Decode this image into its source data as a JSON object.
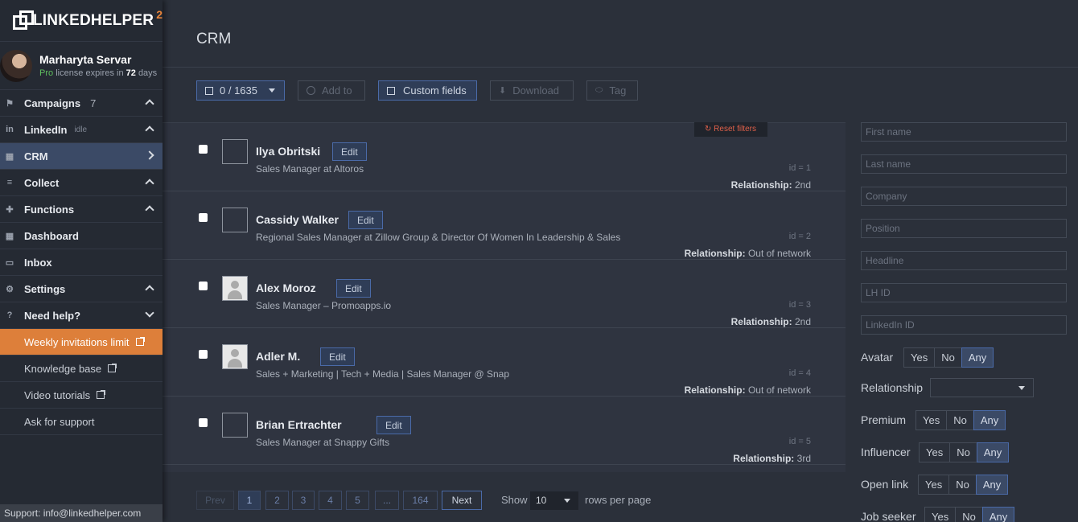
{
  "brand": {
    "name": "LINKEDHELPER",
    "version": "2"
  },
  "user": {
    "name": "Marharyta Servar",
    "plan": "Pro",
    "license_pre": "license expires in",
    "days": "72",
    "days_suffix": "days"
  },
  "nav": [
    {
      "label": "Campaigns",
      "icon": "flag-icon",
      "count": "7",
      "chev": "up"
    },
    {
      "label": "LinkedIn",
      "icon": "linkedin-icon",
      "sub": "idle",
      "chev": "up"
    },
    {
      "label": "CRM",
      "icon": "grid-icon",
      "chev": "right",
      "active": true
    },
    {
      "label": "Collect",
      "icon": "collect-icon",
      "chev": "up"
    },
    {
      "label": "Functions",
      "icon": "puzzle-icon",
      "chev": "up"
    },
    {
      "label": "Dashboard",
      "icon": "dashboard-icon"
    },
    {
      "label": "Inbox",
      "icon": "inbox-icon"
    },
    {
      "label": "Settings",
      "icon": "gear-icon",
      "chev": "up"
    },
    {
      "label": "Need help?",
      "icon": "help-icon",
      "chev": "down"
    }
  ],
  "help_links": [
    {
      "label": "Weekly invitations limit",
      "highlight": true
    },
    {
      "label": "Knowledge base"
    },
    {
      "label": "Video tutorials"
    },
    {
      "label": "Ask for support"
    }
  ],
  "support_text": "Support: info@linkedhelper.com",
  "page_title": "CRM",
  "toolbar": {
    "selection": "0 / 1635",
    "add_to": "Add to",
    "custom_fields": "Custom fields",
    "download": "Download",
    "tag": "Tag"
  },
  "reset_filters": "Reset filters",
  "rows": [
    {
      "name": "Ilya Obritski",
      "title": "Sales Manager at Altoros",
      "id": "id = 1",
      "relationship": "2nd",
      "placeholder": false
    },
    {
      "name": "Cassidy Walker",
      "title": "Regional Sales Manager at Zillow Group & Director Of Women In Leadership & Sales",
      "id": "id = 2",
      "relationship": "Out of network",
      "placeholder": false
    },
    {
      "name": "Alex Moroz",
      "title": "Sales Manager – Promoapps.io",
      "id": "id = 3",
      "relationship": "2nd",
      "placeholder": true
    },
    {
      "name": "Adler M.",
      "title": "Sales + Marketing | Tech + Media | Sales Manager @ Snap",
      "id": "id = 4",
      "relationship": "Out of network",
      "placeholder": true
    },
    {
      "name": "Brian Ertrachter",
      "title": "Sales Manager at Snappy Gifts",
      "id": "id = 5",
      "relationship": "3rd",
      "placeholder": false
    }
  ],
  "edit_label": "Edit",
  "relationship_label": "Relationship:",
  "pagination": {
    "prev": "Prev",
    "pages": [
      "1",
      "2",
      "3",
      "4",
      "5",
      "...",
      "164"
    ],
    "next": "Next",
    "show": "Show",
    "per_page": "10",
    "suffix": "rows per page"
  },
  "filters": {
    "placeholders": [
      "First name",
      "Last name",
      "Company",
      "Position",
      "Headline",
      "LH ID",
      "LinkedIn ID"
    ],
    "avatar": "Avatar",
    "relationship": "Relationship",
    "premium": "Premium",
    "influencer": "Influencer",
    "open_link": "Open link",
    "job_seeker": "Job seeker",
    "yes": "Yes",
    "no": "No",
    "any": "Any"
  },
  "colors": {
    "accent": "#dd7f3a",
    "active": "#3b4a66",
    "bg": "#2b303a"
  }
}
